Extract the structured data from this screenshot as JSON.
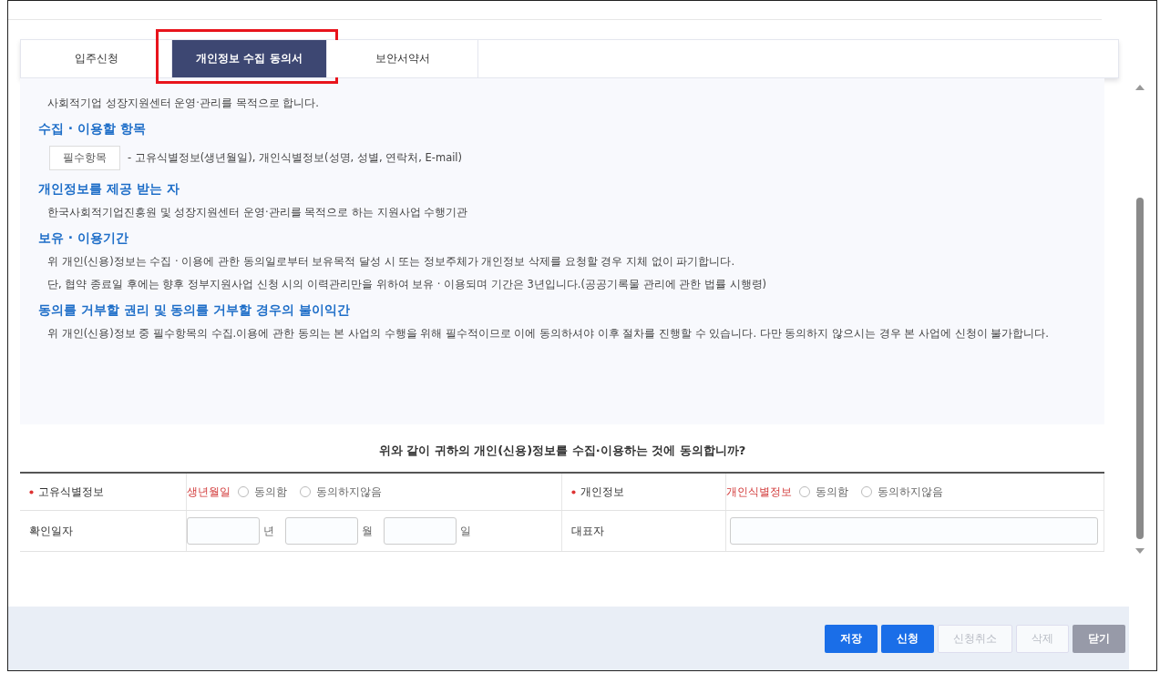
{
  "tabs": [
    {
      "label": "입주신청",
      "selected": false,
      "highlighted": false
    },
    {
      "label": "개인정보 수집 동의서",
      "selected": true,
      "highlighted": true
    },
    {
      "label": "보안서약서",
      "selected": false,
      "highlighted": false
    }
  ],
  "sections": [
    {
      "items": [
        {
          "kind": "bullet",
          "text": "사회적기업 성장지원센터 운영·관리를 목적으로 합니다."
        }
      ]
    },
    {
      "heading": "수집 · 이용할 항목",
      "items": [
        {
          "kind": "tagged",
          "tag": "필수항목",
          "text": "- 고유식별정보(생년월일), 개인식별정보(성명, 성별, 연락처, E-mail)"
        }
      ]
    },
    {
      "heading": "개인정보를 제공 받는 자",
      "items": [
        {
          "kind": "bullet",
          "text": "한국사회적기업진흥원 및 성장지원센터 운영·관리를 목적으로 하는 지원사업 수행기관"
        }
      ]
    },
    {
      "heading": "보유 · 이용기간",
      "items": [
        {
          "kind": "bullet",
          "text": "위 개인(신용)정보는 수집 · 이용에 관한 동의일로부터 보유목적 달성 시 또는 정보주체가 개인정보 삭제를 요청할 경우 지체 없이 파기합니다."
        },
        {
          "kind": "bullet",
          "text": "단, 협약 종료일 후에는 향후 정부지원사업 신청 시의 이력관리만을 위하여 보유 · 이용되며 기간은 3년입니다.(공공기록물 관리에 관한 법률 시행령)"
        }
      ]
    },
    {
      "heading": "동의를 거부할 권리 및 동의를 거부할 경우의 불이익간",
      "items": [
        {
          "kind": "bullet",
          "text": "위 개인(신용)정보 중 필수항목의 수집.이용에 관한 동의는 본 사업의 수행을 위해 필수적이므로 이에 동의하셔야 이후 절차를 진행할 수 있습니다. 다만 동의하지 않으시는 경우 본 사업에 신청이 불가합니다."
        }
      ]
    }
  ],
  "question": "위와 같이 귀하의 개인(신용)정보를 수집·이용하는 것에 동의합니까?",
  "consents": [
    {
      "required": true,
      "label": "고유식별정보",
      "item": "생년월일",
      "options": [
        {
          "label": "동의함",
          "selected": false
        },
        {
          "label": "동의하지않음",
          "selected": false
        }
      ]
    },
    {
      "required": true,
      "label": "개인정보",
      "item": "개인식별정보",
      "options": [
        {
          "label": "동의함",
          "selected": false
        },
        {
          "label": "동의하지않음",
          "selected": false
        }
      ]
    }
  ],
  "date_row": {
    "label": "확인일자",
    "units": [
      "년",
      "월",
      "일"
    ]
  },
  "representative": {
    "label": "대표자"
  },
  "buttons": [
    {
      "label": "저장",
      "kind": "primary",
      "disabled": false
    },
    {
      "label": "신청",
      "kind": "primary",
      "disabled": false
    },
    {
      "label": "신청취소",
      "kind": "outline",
      "disabled": true
    },
    {
      "label": "삭제",
      "kind": "outline",
      "disabled": true
    },
    {
      "label": "닫기",
      "kind": "secondary",
      "disabled": false
    }
  ]
}
